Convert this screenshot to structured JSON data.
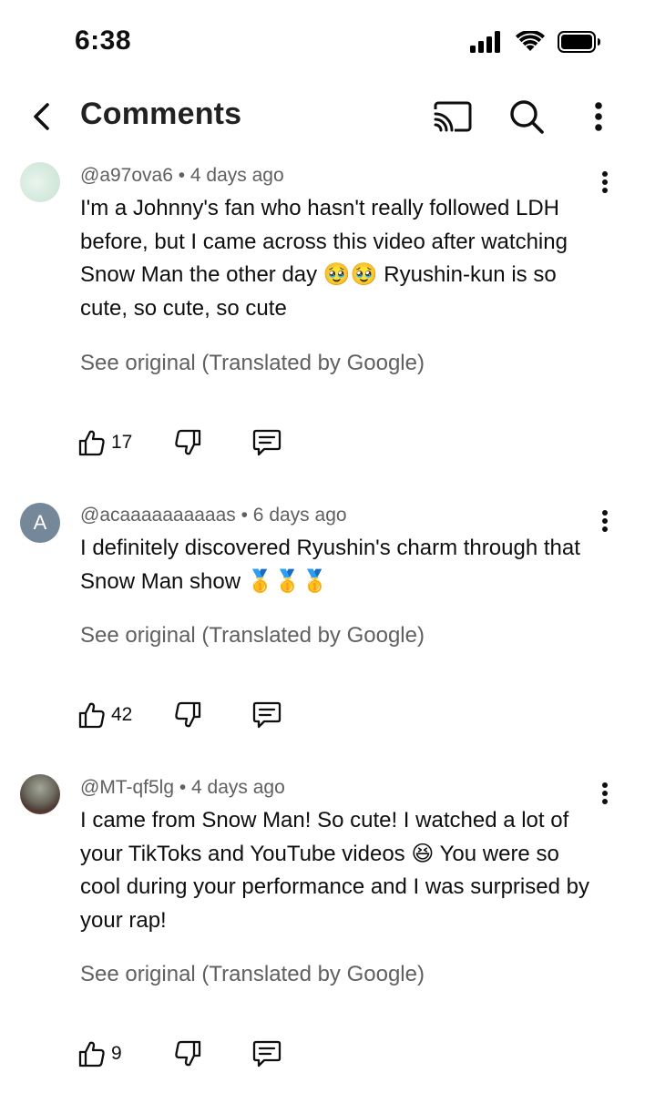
{
  "status_bar": {
    "time": "6:38",
    "icons": [
      "signal-icon",
      "wifi-icon",
      "battery-icon"
    ]
  },
  "header": {
    "title": "Comments",
    "icons": [
      "back-icon",
      "cast-icon",
      "search-icon",
      "more-vert-icon"
    ]
  },
  "comments": [
    {
      "avatar": "image",
      "meta": "@a97ova6 • 4 days ago",
      "text": "I'm a Johnny's fan who hasn't really followed LDH before, but I came across this video after watching Snow Man the other day 🥹🥹 Ryushin-kun is so cute, so cute, so cute",
      "translation_link": "See original (Translated by Google)",
      "likes": "17"
    },
    {
      "avatar": "A",
      "meta": "@acaaaaaaaaaas • 6 days ago",
      "text": "I definitely discovered Ryushin's charm through that Snow Man show 🥇🥇🥇",
      "translation_link": "See original (Translated by Google)",
      "likes": "42"
    },
    {
      "avatar": "image",
      "meta": "@MT-qf5lg • 4 days ago",
      "text": "I came from Snow Man! So cute! I watched a lot of your TikToks and YouTube videos 😆 You were so cool during your performance and I was surprised by your rap!",
      "translation_link": "See original (Translated by Google)",
      "likes": "9"
    }
  ]
}
